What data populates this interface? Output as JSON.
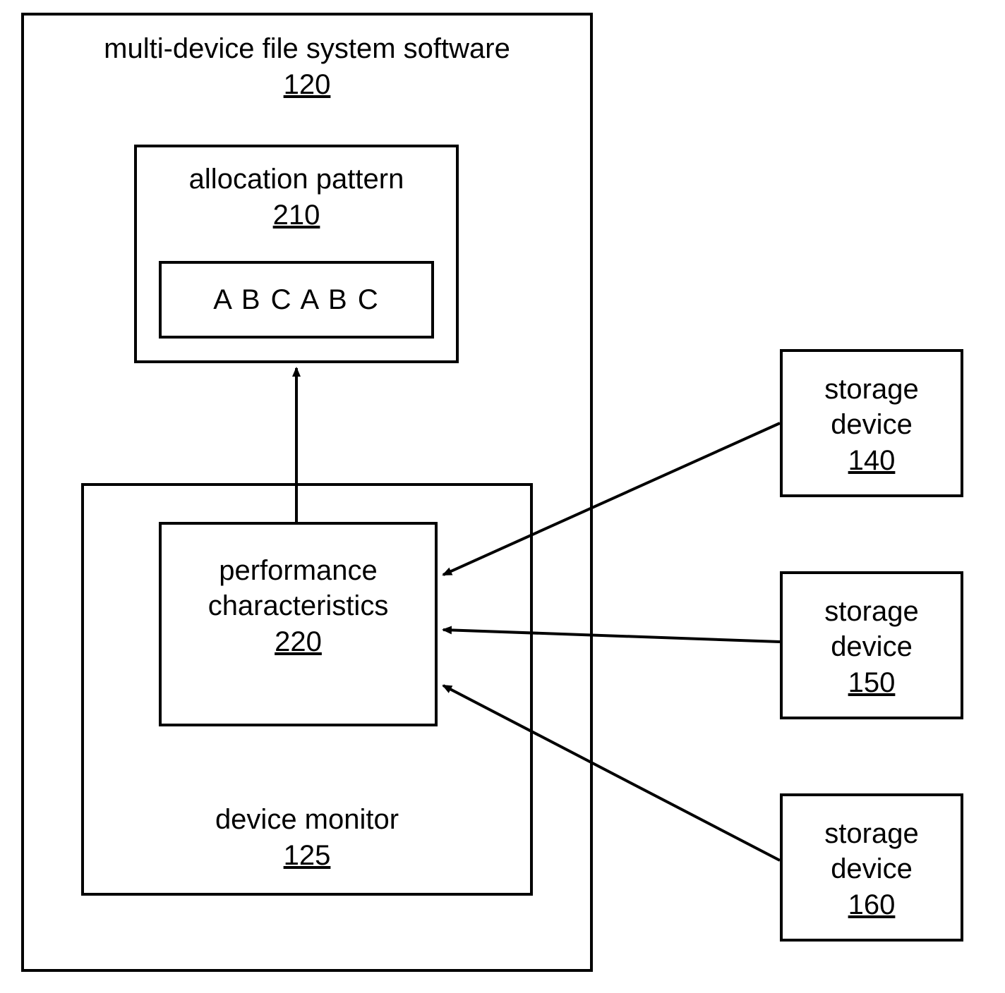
{
  "main_box": {
    "title": "multi-device file system software",
    "ref": "120"
  },
  "allocation_pattern": {
    "title": "allocation pattern",
    "ref": "210",
    "sequence": "A B C A B C"
  },
  "device_monitor": {
    "title": "device monitor",
    "ref": "125"
  },
  "performance": {
    "title": "performance characteristics",
    "ref": "220"
  },
  "storage_devices": [
    {
      "title": "storage device",
      "ref": "140"
    },
    {
      "title": "storage device",
      "ref": "150"
    },
    {
      "title": "storage device",
      "ref": "160"
    }
  ]
}
